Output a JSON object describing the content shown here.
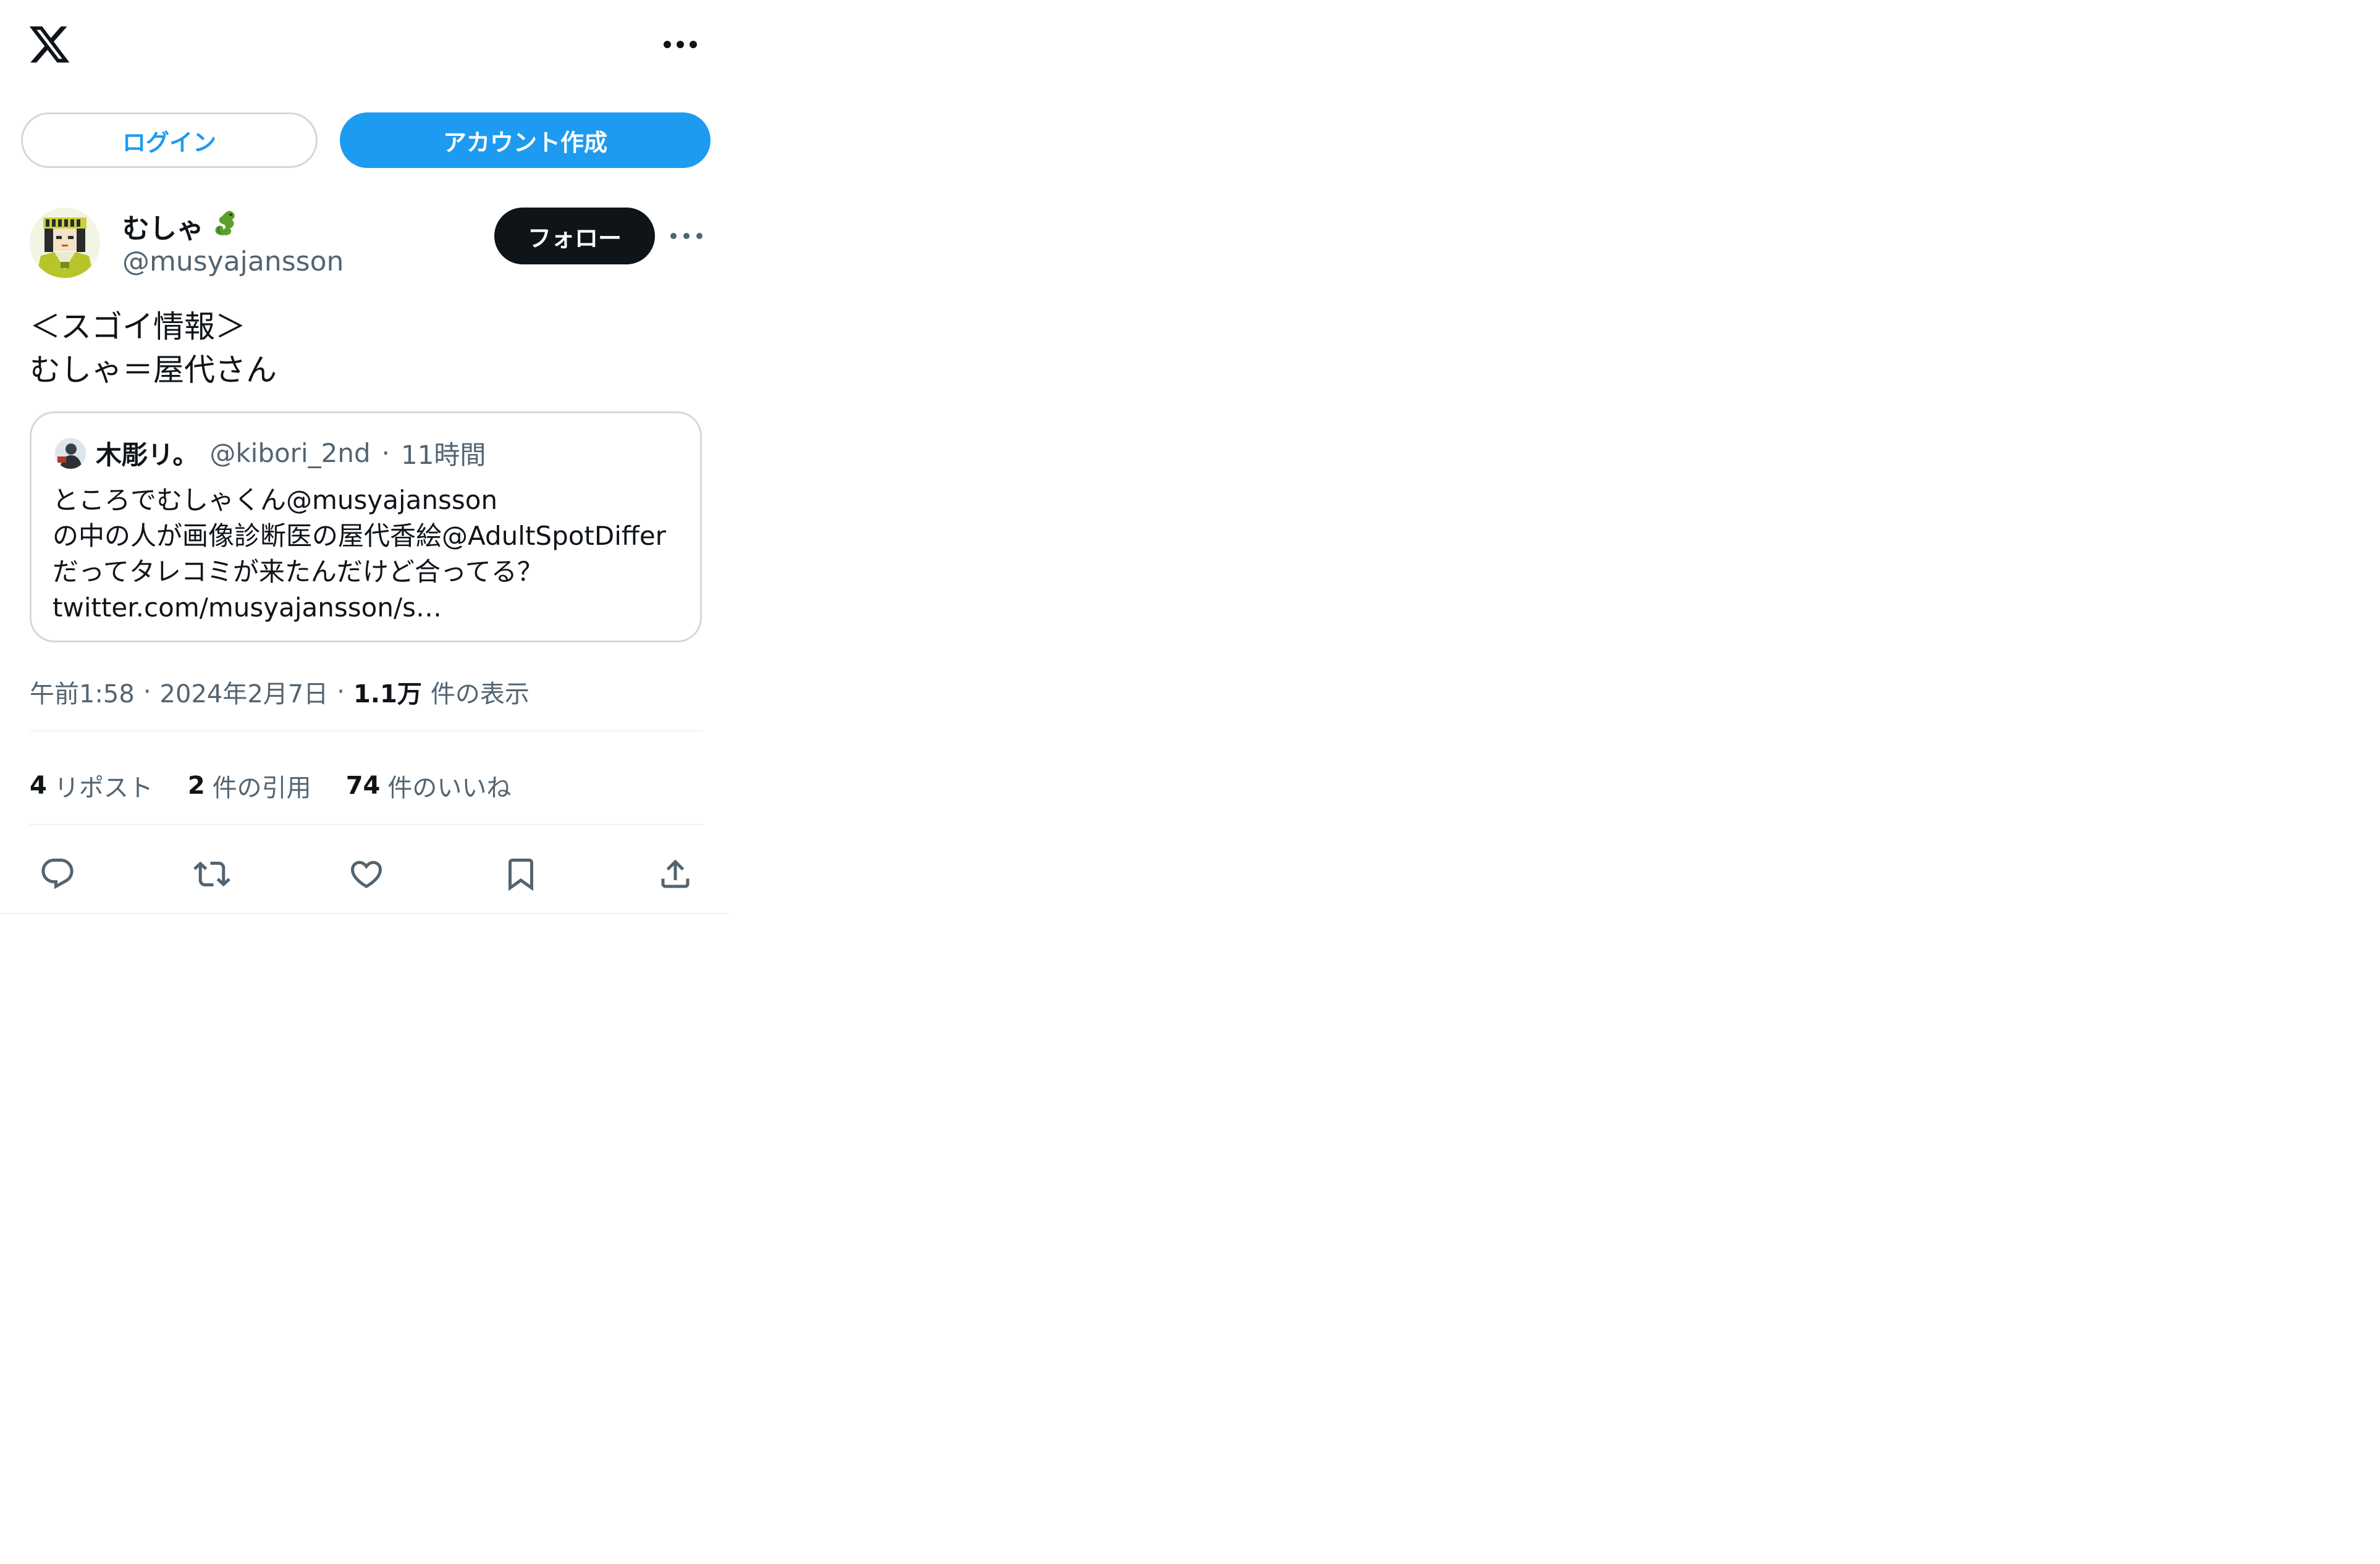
{
  "header": {
    "logo_icon": "x-logo-icon",
    "more_icon": "more-horizontal-icon"
  },
  "auth": {
    "login_label": "ログイン",
    "signup_label": "アカウント作成",
    "accent_color": "#1d9bf0"
  },
  "tweet": {
    "author": {
      "display_name": "むしゃ",
      "name_emoji": "🐉",
      "handle": "@musyajansson"
    },
    "follow_label": "フォロー",
    "text": "＜スゴイ情報＞\nむしゃ＝屋代さん",
    "quote": {
      "name": "木彫リ。",
      "handle": "@kibori_2nd",
      "separator": "·",
      "time": "11時間",
      "text": "ところでむしゃくん@musyajansson\nの中の人が画像診断医の屋代香絵@AdultSpotDiffer\nだってタレコミが来たんだけど合ってる？\ntwitter.com/musyajansson/s…"
    },
    "meta": {
      "time": "午前1:58",
      "dot1": "·",
      "date": "2024年2月7日",
      "dot2": "·",
      "views_count": "1.1万",
      "views_label": "件の表示"
    },
    "stats": {
      "reposts_count": "4",
      "reposts_label": "リポスト",
      "quotes_count": "2",
      "quotes_label": "件の引用",
      "likes_count": "74",
      "likes_label": "件のいいね"
    },
    "actions": [
      "reply-icon",
      "repost-icon",
      "like-icon",
      "bookmark-icon",
      "share-icon"
    ]
  }
}
